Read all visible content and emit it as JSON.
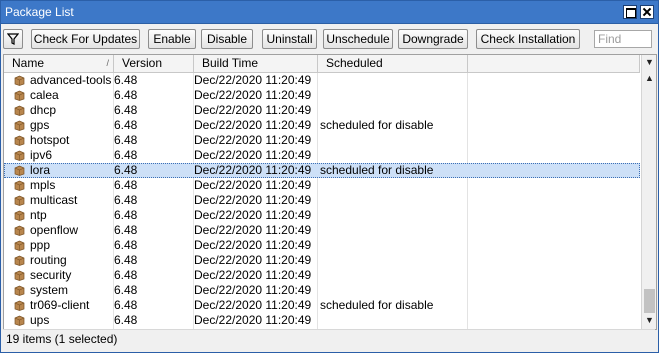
{
  "window": {
    "title": "Package List"
  },
  "toolbar": {
    "buttons": [
      "Check For Updates",
      "Enable",
      "Disable",
      "Uninstall",
      "Unschedule",
      "Downgrade",
      "Check Installation"
    ],
    "find_placeholder": "Find"
  },
  "table": {
    "columns": [
      "Name",
      "Version",
      "Build Time",
      "Scheduled"
    ],
    "sort_indicator": "/",
    "rows": [
      {
        "name": "advanced-tools",
        "version": "6.48",
        "build_time": "Dec/22/2020 11:20:49",
        "scheduled": ""
      },
      {
        "name": "calea",
        "version": "6.48",
        "build_time": "Dec/22/2020 11:20:49",
        "scheduled": ""
      },
      {
        "name": "dhcp",
        "version": "6.48",
        "build_time": "Dec/22/2020 11:20:49",
        "scheduled": ""
      },
      {
        "name": "gps",
        "version": "6.48",
        "build_time": "Dec/22/2020 11:20:49",
        "scheduled": "scheduled for disable"
      },
      {
        "name": "hotspot",
        "version": "6.48",
        "build_time": "Dec/22/2020 11:20:49",
        "scheduled": ""
      },
      {
        "name": "ipv6",
        "version": "6.48",
        "build_time": "Dec/22/2020 11:20:49",
        "scheduled": ""
      },
      {
        "name": "lora",
        "version": "6.48",
        "build_time": "Dec/22/2020 11:20:49",
        "scheduled": "scheduled for disable",
        "selected": true
      },
      {
        "name": "mpls",
        "version": "6.48",
        "build_time": "Dec/22/2020 11:20:49",
        "scheduled": ""
      },
      {
        "name": "multicast",
        "version": "6.48",
        "build_time": "Dec/22/2020 11:20:49",
        "scheduled": ""
      },
      {
        "name": "ntp",
        "version": "6.48",
        "build_time": "Dec/22/2020 11:20:49",
        "scheduled": ""
      },
      {
        "name": "openflow",
        "version": "6.48",
        "build_time": "Dec/22/2020 11:20:49",
        "scheduled": ""
      },
      {
        "name": "ppp",
        "version": "6.48",
        "build_time": "Dec/22/2020 11:20:49",
        "scheduled": ""
      },
      {
        "name": "routing",
        "version": "6.48",
        "build_time": "Dec/22/2020 11:20:49",
        "scheduled": ""
      },
      {
        "name": "security",
        "version": "6.48",
        "build_time": "Dec/22/2020 11:20:49",
        "scheduled": ""
      },
      {
        "name": "system",
        "version": "6.48",
        "build_time": "Dec/22/2020 11:20:49",
        "scheduled": ""
      },
      {
        "name": "tr069-client",
        "version": "6.48",
        "build_time": "Dec/22/2020 11:20:49",
        "scheduled": "scheduled for disable"
      },
      {
        "name": "ups",
        "version": "6.48",
        "build_time": "Dec/22/2020 11:20:49",
        "scheduled": ""
      }
    ]
  },
  "status": {
    "text": "19 items (1 selected)"
  },
  "colors": {
    "titlebar": "#3d78c8",
    "selection": "#cde0f7",
    "package_icon": "#b8864e"
  },
  "icons": {
    "filter": "filter-icon",
    "package": "package-icon",
    "restore": "restore-icon",
    "close": "close-icon"
  }
}
